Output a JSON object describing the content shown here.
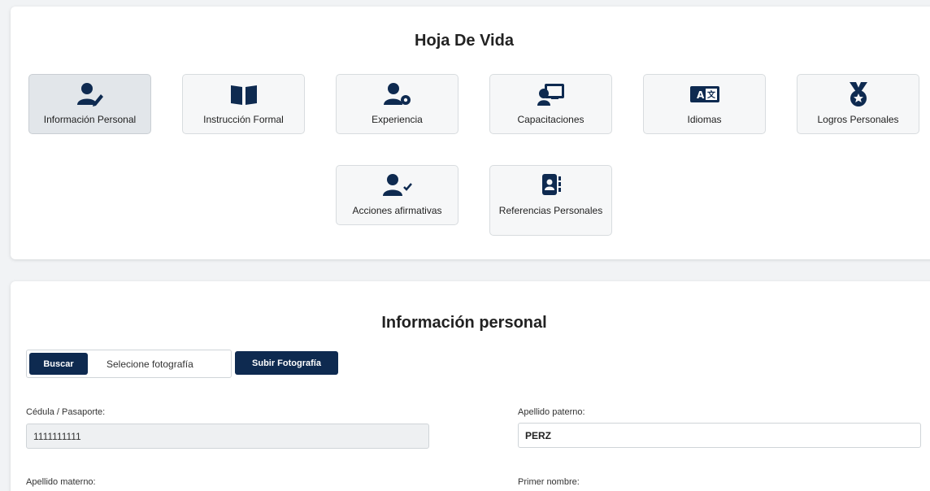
{
  "cv": {
    "title": "Hoja De Vida",
    "tiles": [
      {
        "label": "Información Personal",
        "icon": "user-edit-icon"
      },
      {
        "label": "Instrucción Formal",
        "icon": "book-open-icon"
      },
      {
        "label": "Experiencia",
        "icon": "user-gear-icon"
      },
      {
        "label": "Capacitaciones",
        "icon": "chalkboard-teacher-icon"
      },
      {
        "label": "Idiomas",
        "icon": "language-icon"
      },
      {
        "label": "Logros Personales",
        "icon": "medal-icon"
      },
      {
        "label": "Acciones afirmativas",
        "icon": "user-check-icon"
      },
      {
        "label": "Referencias Personales",
        "icon": "address-book-icon"
      }
    ]
  },
  "info": {
    "title": "Información personal",
    "browse_label": "Buscar",
    "file_placeholder": "Selecione fotografía",
    "upload_label": "Subir Fotografía",
    "fields": {
      "cedula": {
        "label": "Cédula / Pasaporte:",
        "value": "1111111111"
      },
      "apellido_paterno": {
        "label": "Apellido paterno:",
        "value": "PERZ"
      },
      "apellido_materno": {
        "label": "Apellido materno:",
        "value": ""
      },
      "primer_nombre": {
        "label": "Primer nombre:",
        "value": ""
      }
    }
  },
  "colors": {
    "accent": "#0e2a50",
    "tile_bg": "#f6f7f8",
    "tile_active_bg": "#e2e6ea"
  }
}
